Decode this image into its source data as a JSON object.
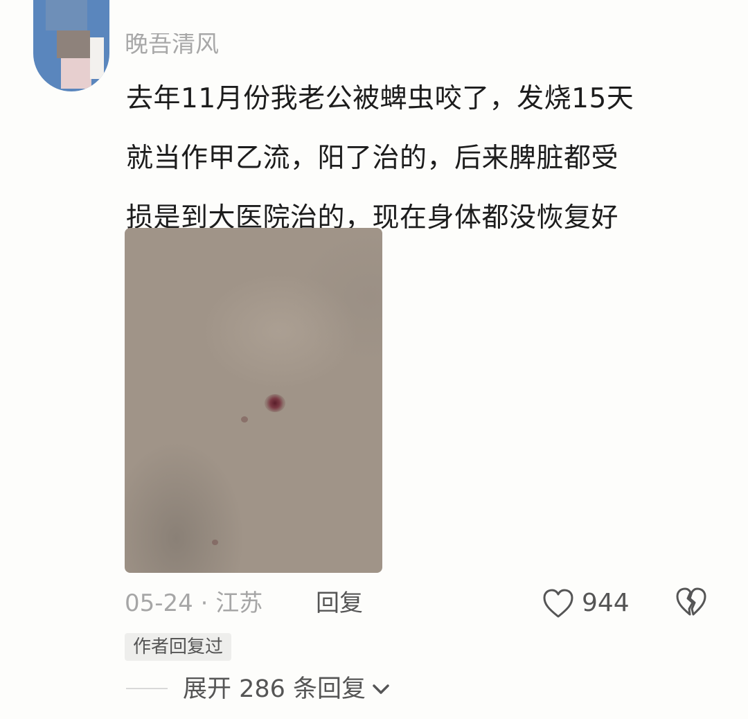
{
  "comment": {
    "username": "晚吾清风",
    "lines": [
      "去年11月份我老公被蜱虫咬了，发烧15天",
      "就当作甲乙流，阳了治的，后来脾脏都受",
      "损是到大医院治的，现在身体都没恢复好"
    ],
    "date": "05-24",
    "separator": "·",
    "location": "江苏",
    "reply_label": "回复",
    "like_count": "944",
    "author_tag": "作者回复过",
    "expand_label": "展开 286 条回复",
    "icons": {
      "like": "heart-outline-icon",
      "dislike": "broken-heart-icon",
      "expand": "chevron-down-icon"
    }
  },
  "colors": {
    "text_primary": "#1c1c1c",
    "text_secondary": "#a6a6a6",
    "background": "#fdfdfb"
  }
}
